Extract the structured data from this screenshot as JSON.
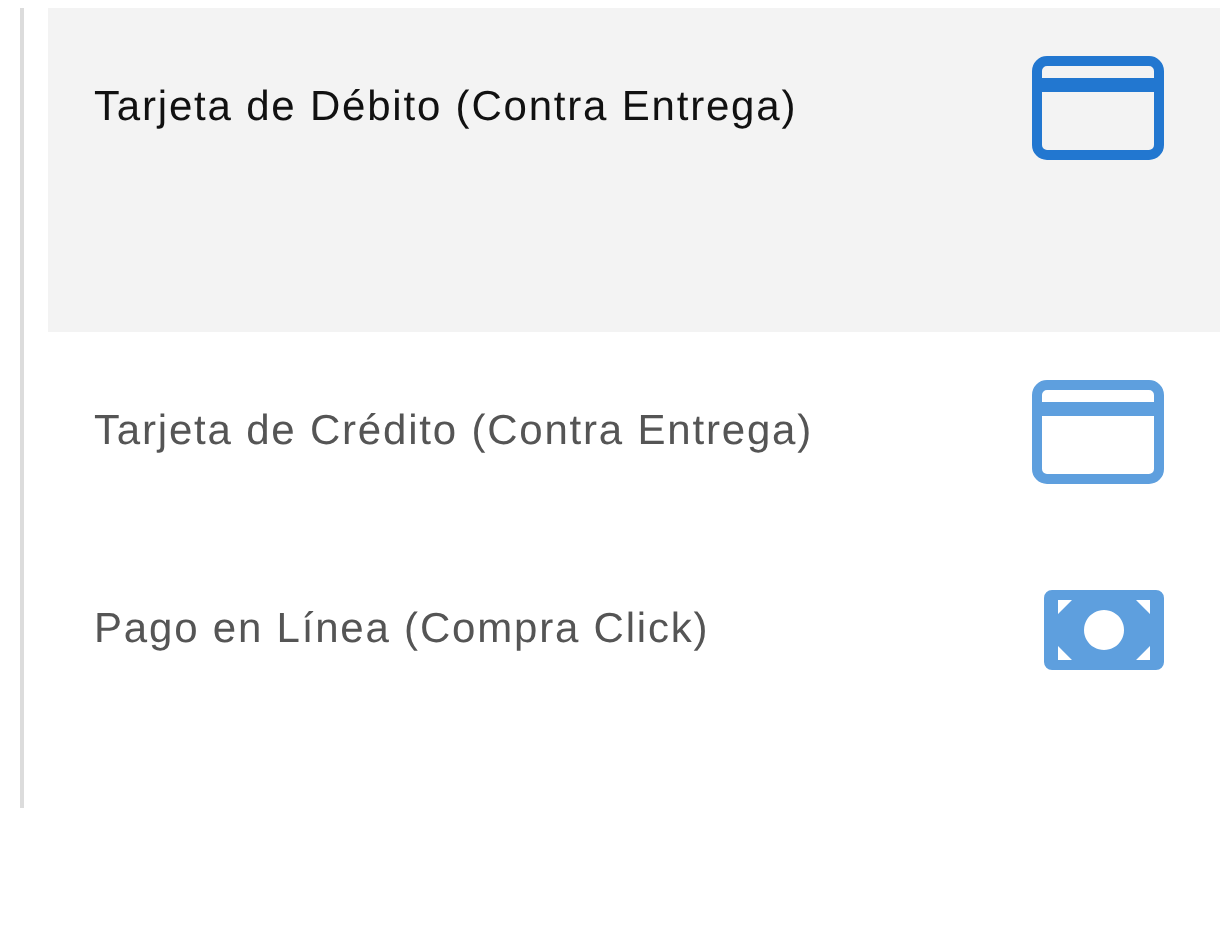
{
  "payment_options": [
    {
      "label": "Tarjeta de Débito (Contra Entrega)",
      "kind": "card",
      "selected": true
    },
    {
      "label": "Tarjeta de Crédito (Contra Entrega)",
      "kind": "card",
      "selected": false
    },
    {
      "label": "Pago en Línea (Compra Click)",
      "kind": "cash",
      "selected": false
    }
  ]
}
